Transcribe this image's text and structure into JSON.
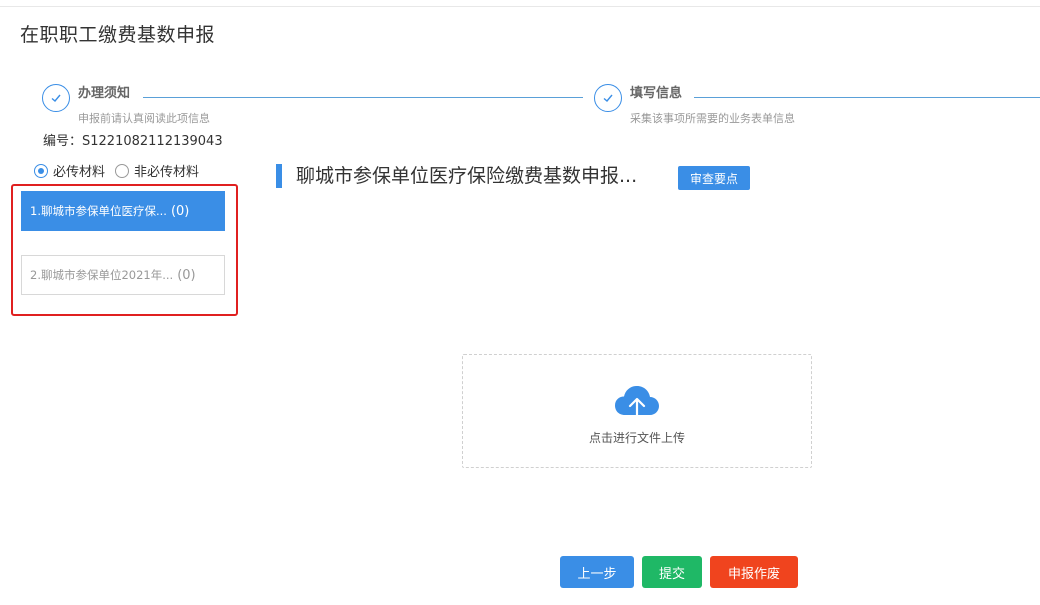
{
  "page": {
    "title": "在职职工缴费基数申报"
  },
  "steps": [
    {
      "title": "办理须知",
      "desc": "申报前请认真阅读此项信息"
    },
    {
      "title": "填写信息",
      "desc": "采集该事项所需要的业务表单信息"
    }
  ],
  "serial": "编号：S1221082112139043",
  "radios": {
    "required": "必传材料",
    "optional": "非必传材料",
    "selected": "必传材料"
  },
  "materials": [
    {
      "label": "1.聊城市参保单位医疗保...",
      "count": "(0)",
      "active": true
    },
    {
      "label": "2.聊城市参保单位2021年...",
      "count": "(0)",
      "active": false
    }
  ],
  "section": {
    "title": "聊城市参保单位医疗保险缴费基数申报...",
    "review_button": "审查要点"
  },
  "upload": {
    "text": "点击进行文件上传",
    "icon": "cloud-upload-icon"
  },
  "buttons": {
    "prev": "上一步",
    "submit": "提交",
    "void": "申报作废"
  },
  "colors": {
    "primary": "#3a8ee6",
    "success": "#1fb866",
    "danger": "#f0441e",
    "highlight": "#e02020"
  }
}
